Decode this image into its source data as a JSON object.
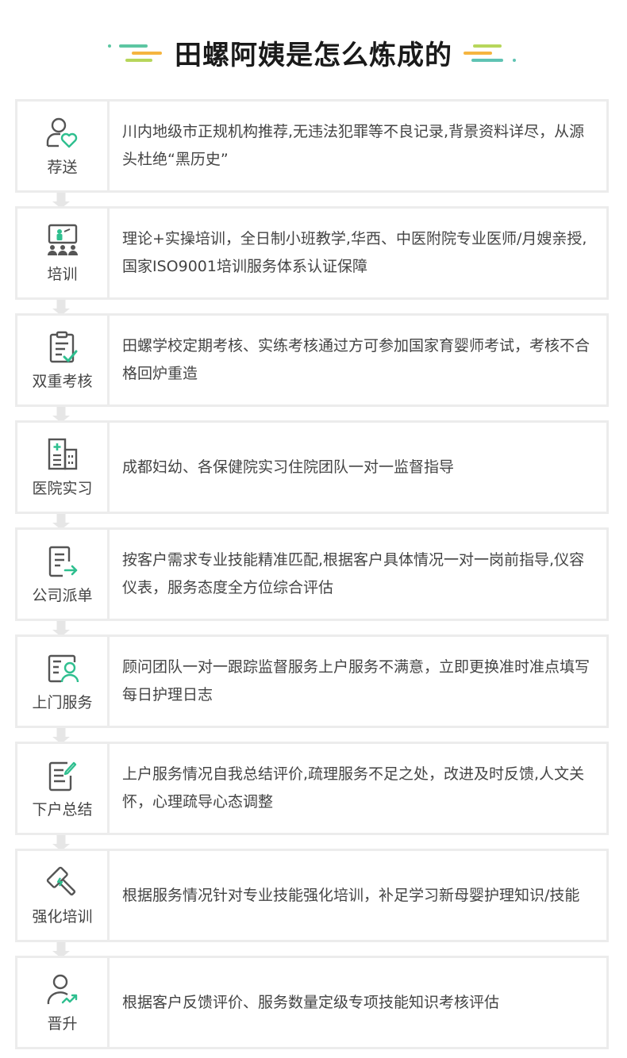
{
  "header": {
    "title": "田螺阿姨是怎么炼成的",
    "colors": {
      "green": "#5cc6a2",
      "orange": "#f5b540",
      "lime": "#b7d65b",
      "teal": "#5fc3b3"
    }
  },
  "steps": [
    {
      "label": "荐送",
      "icon": "user-heart-icon",
      "text": "川内地级市正规机构推荐,无违法犯罪等不良记录,背景资料详尽，从源头杜绝“黑历史”"
    },
    {
      "label": "培训",
      "icon": "classroom-icon",
      "text": "理论+实操培训，全日制小班教学,华西、中医附院专业医师/月嫂亲授,国家ISO9001培训服务体系认证保障"
    },
    {
      "label": "双重考核",
      "icon": "clipboard-check-icon",
      "text": "田螺学校定期考核、实练考核通过方可参加国家育婴师考试，考核不合格回炉重造"
    },
    {
      "label": "医院实习",
      "icon": "hospital-icon",
      "text": "成都妇幼、各保健院实习住院团队一对一监督指导"
    },
    {
      "label": "公司派单",
      "icon": "document-arrow-icon",
      "text": "按客户需求专业技能精准匹配,根据客户具体情况一对一岗前指导,仪容仪表，服务态度全方位综合评估"
    },
    {
      "label": "上门服务",
      "icon": "id-card-user-icon",
      "text": "顾问团队一对一跟踪监督服务上户服务不满意，立即更换准时准点填写每日护理日志"
    },
    {
      "label": "下户总结",
      "icon": "note-pencil-icon",
      "text": "上户服务情况自我总结评价,疏理服务不足之处，改进及时反馈,人文关怀，心理疏导心态调整"
    },
    {
      "label": "强化培训",
      "icon": "hammer-icon",
      "text": "根据服务情况针对专业技能强化培训，补足学习新母婴护理知识/技能"
    },
    {
      "label": "晋升",
      "icon": "user-growth-icon",
      "text": "根据客户反馈评价、服务数量定级专项技能知识考核评估"
    }
  ]
}
